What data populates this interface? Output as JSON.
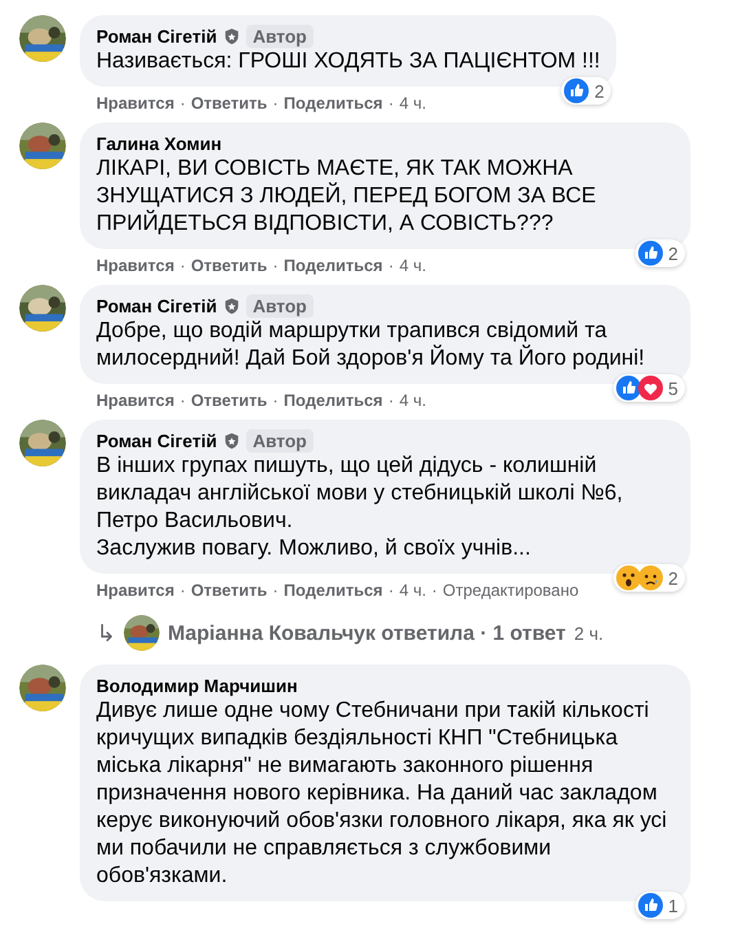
{
  "comments": [
    {
      "author": "Роман Сігетій",
      "author_badge": "Автор",
      "text": "Називається: ГРОШІ ХОДЯТЬ ЗА ПАЦІЄНТОМ !!!",
      "reactions": {
        "icons": [
          {
            "kind": "like"
          }
        ],
        "count": "2"
      },
      "actions": [
        {
          "kind": "link",
          "text": "Нравится"
        },
        {
          "kind": "sep",
          "text": "·"
        },
        {
          "kind": "link",
          "text": "Ответить"
        },
        {
          "kind": "sep",
          "text": "·"
        },
        {
          "kind": "link",
          "text": "Поделиться"
        },
        {
          "kind": "sep",
          "text": "·"
        },
        {
          "kind": "time",
          "text": "4 ч."
        }
      ]
    },
    {
      "author": "Галина Хомин",
      "text": "ЛІКАРІ, ВИ СОВІСТЬ МАЄТЕ, ЯК ТАК МОЖНА ЗНУЩАТИСЯ З ЛЮДЕЙ, ПЕРЕД БОГОМ ЗА ВСЕ ПРИЙДЕТЬСЯ ВІДПОВІСТИ, А СОВІСТЬ???",
      "reactions": {
        "icons": [
          {
            "kind": "like"
          }
        ],
        "count": "2"
      },
      "actions": [
        {
          "kind": "link",
          "text": "Нравится"
        },
        {
          "kind": "sep",
          "text": "·"
        },
        {
          "kind": "link",
          "text": "Ответить"
        },
        {
          "kind": "sep",
          "text": "·"
        },
        {
          "kind": "link",
          "text": "Поделиться"
        },
        {
          "kind": "sep",
          "text": "·"
        },
        {
          "kind": "time",
          "text": "4 ч."
        }
      ]
    },
    {
      "author": "Роман Сігетій",
      "author_badge": "Автор",
      "text": "Добре, що водій маршрутки трапився свідомий та милосердний! Дай Бой здоров'я Йому та Його родині!",
      "reactions": {
        "icons": [
          {
            "kind": "like"
          },
          {
            "kind": "love"
          }
        ],
        "count": "5"
      },
      "actions": [
        {
          "kind": "link",
          "text": "Нравится"
        },
        {
          "kind": "sep",
          "text": "·"
        },
        {
          "kind": "link",
          "text": "Ответить"
        },
        {
          "kind": "sep",
          "text": "·"
        },
        {
          "kind": "link",
          "text": "Поделиться"
        },
        {
          "kind": "sep",
          "text": "·"
        },
        {
          "kind": "time",
          "text": "4 ч."
        }
      ]
    },
    {
      "author": "Роман Сігетій",
      "author_badge": "Автор",
      "text": "В інших групах пишуть, що цей дідусь - колишній викладач англійської мови у стебницькій школі №6, Петро Васильович.\nЗаслужив повагу. Можливо, й своїх учнів...",
      "reactions": {
        "icons": [
          {
            "kind": "wow"
          },
          {
            "kind": "sad"
          }
        ],
        "count": "2"
      },
      "actions": [
        {
          "kind": "link",
          "text": "Нравится"
        },
        {
          "kind": "sep",
          "text": "·"
        },
        {
          "kind": "link",
          "text": "Ответить"
        },
        {
          "kind": "sep",
          "text": "·"
        },
        {
          "kind": "link",
          "text": "Поделиться"
        },
        {
          "kind": "sep",
          "text": "·"
        },
        {
          "kind": "time",
          "text": "4 ч."
        },
        {
          "kind": "sep",
          "text": "·"
        },
        {
          "kind": "time",
          "text": "Отредактировано"
        }
      ],
      "replies": {
        "arrow": "↳",
        "link": "Маріанна Ковальчук ответила · 1 ответ",
        "time": "2 ч."
      }
    },
    {
      "author": "Володимир Марчишин",
      "text": "Дивує лише одне чому Стебничани при такій кількості кричущих випадків бездіяльності КНП \"Стебницька міська лікарня\" не вимагають законного рішення призначення нового керівника. На даний час закладом керує виконуючий обов'язки головного лікаря, яка як усі ми побачили не справляється з службовими обов'язками.",
      "reactions": {
        "icons": [
          {
            "kind": "like"
          }
        ],
        "count": "1"
      }
    }
  ]
}
